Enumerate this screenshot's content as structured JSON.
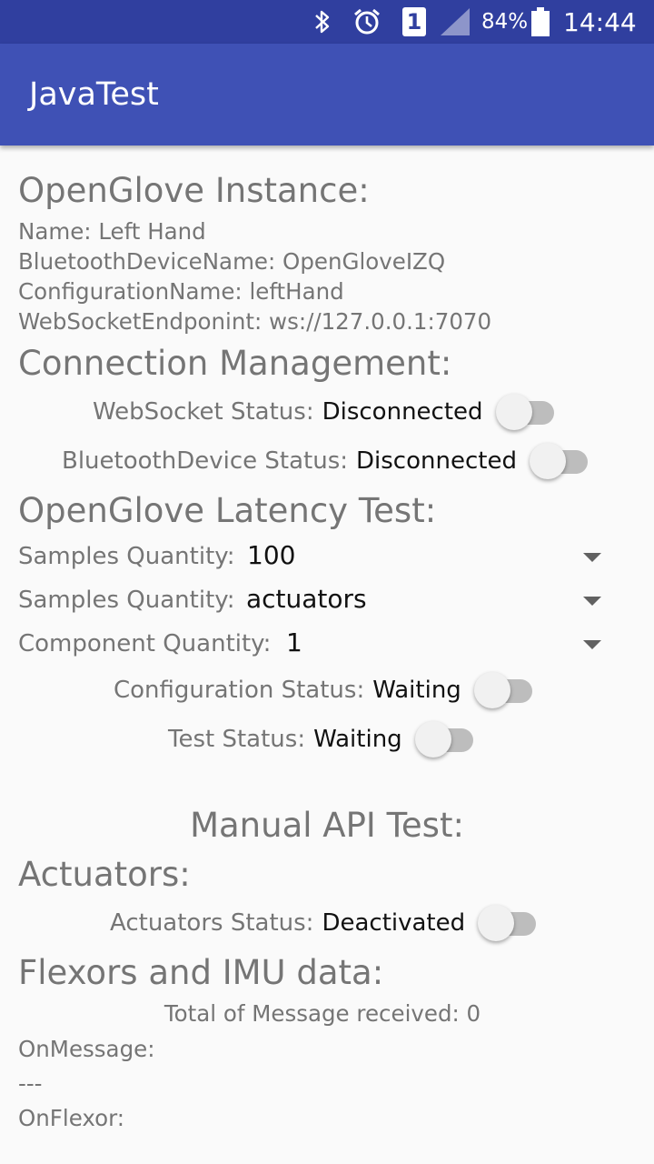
{
  "status_bar": {
    "battery_percent": "84%",
    "time": "14:44",
    "sim_number": "1"
  },
  "app_bar": {
    "title": "JavaTest"
  },
  "instance": {
    "heading": "OpenGlove Instance:",
    "name": "Name: Left Hand",
    "bluetooth_device_name": "BluetoothDeviceName: OpenGloveIZQ",
    "configuration_name": "ConfigurationName: leftHand",
    "websocket_endpoint": "WebSocketEndponint: ws://127.0.0.1:7070"
  },
  "connection": {
    "heading": "Connection Management:",
    "websocket_label": "WebSocket Status:",
    "websocket_value": "Disconnected",
    "bluetooth_label": "BluetoothDevice Status:",
    "bluetooth_value": "Disconnected"
  },
  "latency": {
    "heading": "OpenGlove Latency Test:",
    "samples_label": "Samples Quantity:",
    "samples_value": "100",
    "type_label": "Samples Quantity:",
    "type_value": "actuators",
    "component_label": "Component Quantity:",
    "component_value": "1",
    "config_status_label": "Configuration Status:",
    "config_status_value": "Waiting",
    "test_status_label": "Test Status:",
    "test_status_value": "Waiting"
  },
  "manual": {
    "heading": "Manual API Test:",
    "actuators_heading": "Actuators:",
    "actuators_label": "Actuators Status:",
    "actuators_value": "Deactivated",
    "flexors_heading": "Flexors and IMU data:",
    "total_messages": "Total of Message received: 0",
    "on_message_label": "OnMessage:",
    "on_message_value": "---",
    "on_flexor_label": "OnFlexor:"
  },
  "colors": {
    "status_bar": "#303f9f",
    "app_bar": "#3f51b5",
    "background": "#fafafa"
  }
}
